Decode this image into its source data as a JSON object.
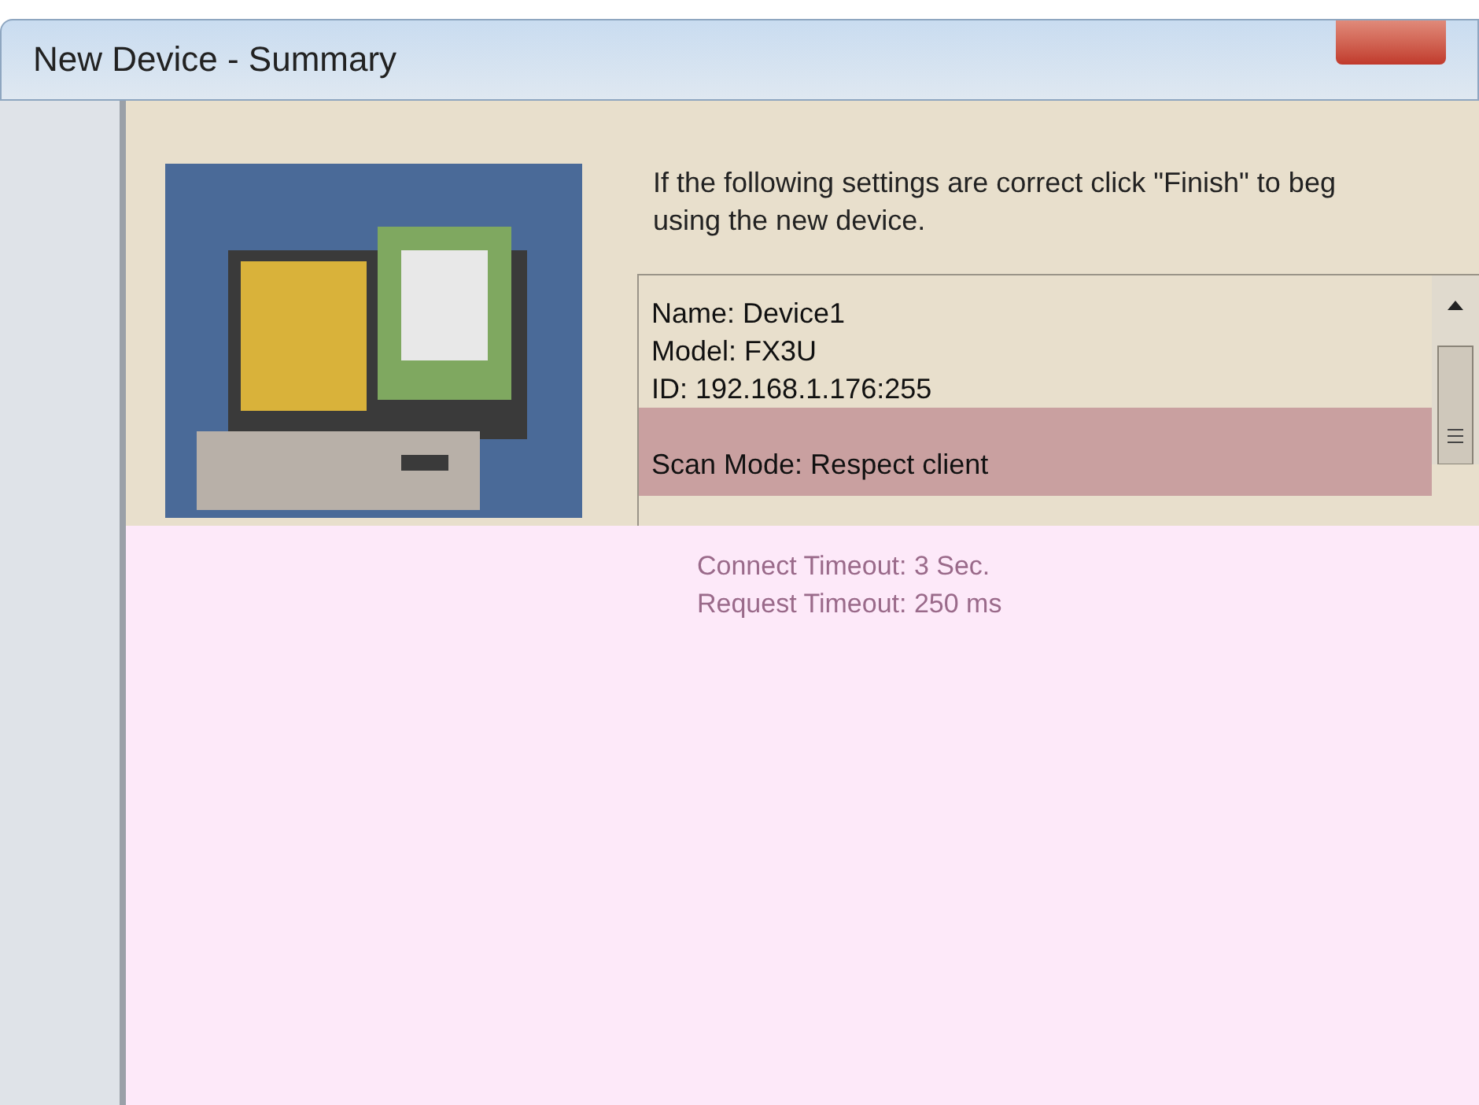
{
  "window": {
    "title": "New Device - Summary"
  },
  "intro": [
    "If the following settings are correct click \"Finish\" to beg",
    "using the new device."
  ],
  "summary": [
    {
      "text": "Name: Device1",
      "selected": false
    },
    {
      "text": "Model: FX3U",
      "selected": false
    },
    {
      "text": "ID: 192.168.1.176:255",
      "selected": false
    },
    {
      "text": "Scan Mode: Respect client",
      "selected": true
    }
  ],
  "details": [
    "Connect Timeout: 3 Sec.",
    "Request Timeout: 250 ms"
  ]
}
